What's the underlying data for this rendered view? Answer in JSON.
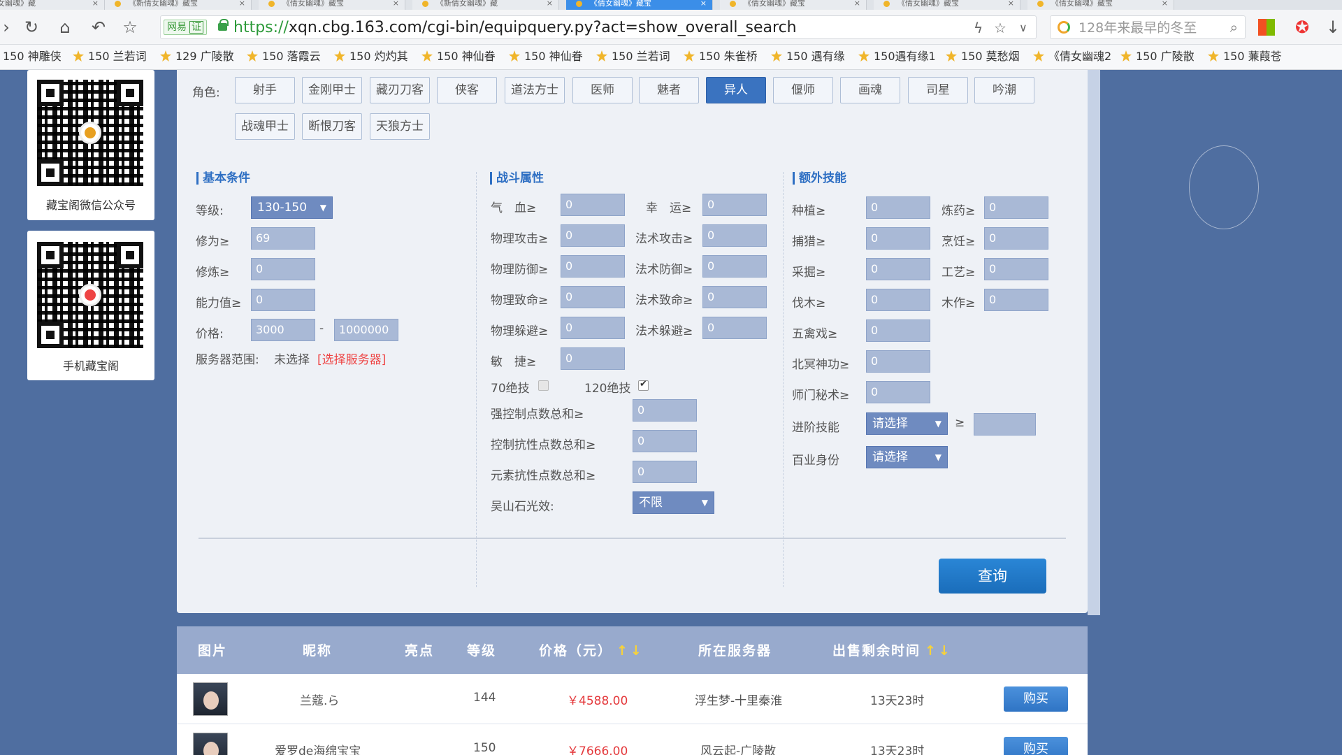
{
  "browser": {
    "tabs": [
      {
        "label": "《倩女幽魂》藏"
      },
      {
        "label": "《新倩女幽魂》藏宝"
      },
      {
        "label": "《倩女幽魂》藏宝"
      },
      {
        "label": "《新倩女幽魂》藏"
      },
      {
        "label": "《倩女幽魂》藏宝",
        "active": true
      },
      {
        "label": "《倩女幽魂》藏宝"
      },
      {
        "label": "《倩女幽魂》藏宝"
      },
      {
        "label": "《倩女幽魂》藏宝"
      }
    ],
    "site_badge": "网易",
    "site_badge_mark": "证",
    "url_scheme": "https://",
    "url_rest": "xqn.cbg.163.com/cgi-bin/equipquery.py?act=show_overall_search",
    "search_placeholder": "128年来最早的冬至",
    "bookmarks": [
      {
        "label": "150 神雕侠",
        "icon": false
      },
      {
        "label": "150 兰若词"
      },
      {
        "label": "129 广陵散"
      },
      {
        "label": "150 落霞云"
      },
      {
        "label": "150 灼灼其"
      },
      {
        "label": "150 神仙眷"
      },
      {
        "label": "150 神仙眷"
      },
      {
        "label": "150 兰若词"
      },
      {
        "label": "150 朱雀桥"
      },
      {
        "label": "150 遇有缘"
      },
      {
        "label": "150遇有缘1"
      },
      {
        "label": "150 莫愁烟"
      },
      {
        "label": "《倩女幽魂2"
      },
      {
        "label": "150 广陵散"
      },
      {
        "label": "150 蒹葭苍"
      }
    ],
    "colors": {
      "active_tab": "#3b8ee8",
      "url_scheme": "#2d9a3a"
    }
  },
  "sidebar": {
    "qr1_label": "藏宝阁微信公众号",
    "qr2_label": "手机藏宝阁"
  },
  "filters": {
    "role_label": "角色:",
    "roles_row1": [
      "射手",
      "金刚甲士",
      "藏刃刀客",
      "侠客",
      "道法方士",
      "医师",
      "魅者",
      "异人",
      "偃师",
      "画魂",
      "司星",
      "吟潮"
    ],
    "roles_row2": [
      "战魂甲士",
      "断恨刀客",
      "天狼方士"
    ],
    "selected_role": "异人",
    "basic": {
      "title": "基本条件",
      "level_label": "等级:",
      "level_value": "130-150",
      "xiuwei_label": "修为≥",
      "xiuwei_value": "69",
      "xiulian_label": "修炼≥",
      "xiulian_value": "0",
      "ability_label": "能力值≥",
      "ability_value": "0",
      "price_label": "价格:",
      "price_min": "3000",
      "price_sep": "-",
      "price_max": "1000000",
      "server_label": "服务器范围:",
      "server_value": "未选择",
      "server_link": "[选择服务器]"
    },
    "combat": {
      "title": "战斗属性",
      "left": [
        {
          "label": "气　血≥",
          "value": "0"
        },
        {
          "label": "物理攻击≥",
          "value": "0"
        },
        {
          "label": "物理防御≥",
          "value": "0"
        },
        {
          "label": "物理致命≥",
          "value": "0"
        },
        {
          "label": "物理躲避≥",
          "value": "0"
        },
        {
          "label": "敏　捷≥",
          "value": "0"
        }
      ],
      "right": [
        {
          "label": "幸　运≥",
          "value": "0"
        },
        {
          "label": "法术攻击≥",
          "value": "0"
        },
        {
          "label": "法术防御≥",
          "value": "0"
        },
        {
          "label": "法术致命≥",
          "value": "0"
        },
        {
          "label": "法术躲避≥",
          "value": "0"
        }
      ],
      "skill70_label": "70绝技",
      "skill70_checked": false,
      "skill120_label": "120绝技",
      "skill120_checked": true,
      "strong_control_label": "强控制点数总和≥",
      "strong_control_value": "0",
      "control_resist_label": "控制抗性点数总和≥",
      "control_resist_value": "0",
      "element_resist_label": "元素抗性点数总和≥",
      "element_resist_value": "0",
      "wushan_label": "吴山石光效:",
      "wushan_value": "不限"
    },
    "extra": {
      "title": "额外技能",
      "pairs": [
        {
          "left_label": "种植≥",
          "left_value": "0",
          "right_label": "炼药≥",
          "right_value": "0"
        },
        {
          "left_label": "捕猎≥",
          "left_value": "0",
          "right_label": "烹饪≥",
          "right_value": "0"
        },
        {
          "left_label": "采掘≥",
          "left_value": "0",
          "right_label": "工艺≥",
          "right_value": "0"
        },
        {
          "left_label": "伐木≥",
          "left_value": "0",
          "right_label": "木作≥",
          "right_value": "0"
        }
      ],
      "wuqinxi_label": "五禽戏≥",
      "wuqinxi_value": "0",
      "beiming_label": "北冥神功≥",
      "beiming_value": "0",
      "shimen_label": "师门秘术≥",
      "shimen_value": "0",
      "advanced_label": "进阶技能",
      "advanced_value": "请选择",
      "advanced_ge": "≥",
      "advanced_input": "",
      "career_label": "百业身份",
      "career_value": "请选择"
    },
    "query_button": "查询",
    "colors": {
      "selected_role": "#3a73c0",
      "section_title": "#2e6fc3",
      "link": "#e44444",
      "query_button": "#1a6dba"
    }
  },
  "results": {
    "headers": [
      "图片",
      "昵称",
      "亮点",
      "等级",
      "价格（元）",
      "所在服务器",
      "出售剩余时间"
    ],
    "sort_arrows": "↑↓",
    "rows": [
      {
        "name": "兰蔻.ら",
        "highlight": "",
        "level": "144",
        "price": "￥4588.00",
        "server": "浮生梦-十里秦淮",
        "time_left": "13天23时",
        "action": "购买"
      },
      {
        "name": "爱罗de海绵宝宝",
        "highlight": "",
        "level": "150",
        "price": "￥7666.00",
        "server": "风云起-广陵散",
        "time_left": "13天23时",
        "action": "购买"
      }
    ],
    "colors": {
      "header_bg": "#98aacd",
      "price": "#e4393c",
      "buy_button": "#2f74c4"
    }
  }
}
